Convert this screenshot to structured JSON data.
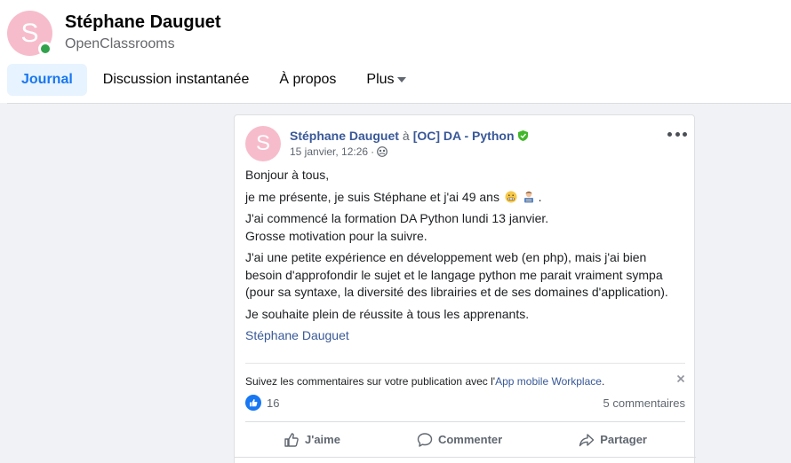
{
  "profile": {
    "avatar_letter": "S",
    "name": "Stéphane Dauguet",
    "organization": "OpenClassrooms",
    "online_color": "#31a24c"
  },
  "tabs": [
    {
      "label": "Journal",
      "active": true
    },
    {
      "label": "Discussion instantanée",
      "active": false
    },
    {
      "label": "À propos",
      "active": false
    },
    {
      "label": "Plus",
      "active": false
    }
  ],
  "post": {
    "avatar_letter": "S",
    "author": "Stéphane Dauguet",
    "connector": "à",
    "group": "[OC] DA - Python",
    "timestamp": "15 janvier, 12:26",
    "separator": "·",
    "paragraphs": [
      "Bonjour à tous,",
      "je me présente, je suis Stéphane et j'ai 49 ans",
      "J'ai commencé la formation DA Python lundi 13 janvier.",
      "Grosse motivation pour la suivre.",
      "J'ai une petite expérience en développement web (en php), mais j'ai bien besoin d'approfondir le sujet et le langage python me parait vraiment sympa (pour sa syntaxe, la diversité des librairies et de ses domaines d'application).",
      "Je souhaite plein de réussite à tous les apprenants."
    ],
    "emojis": [
      "grimacing-face",
      "technologist-woman"
    ],
    "signature": "Stéphane Dauguet",
    "notify_text": "Suivez les commentaires sur votre publication avec l'",
    "notify_link": "App mobile Workplace",
    "notify_end": ".",
    "like_count": "16",
    "comments_count": "5 commentaires",
    "actions": {
      "like": "J'aime",
      "comment": "Commenter",
      "share": "Partager"
    }
  },
  "colors": {
    "accent": "#1877f2",
    "link": "#385898",
    "avatar_bg": "#f7bccb"
  }
}
